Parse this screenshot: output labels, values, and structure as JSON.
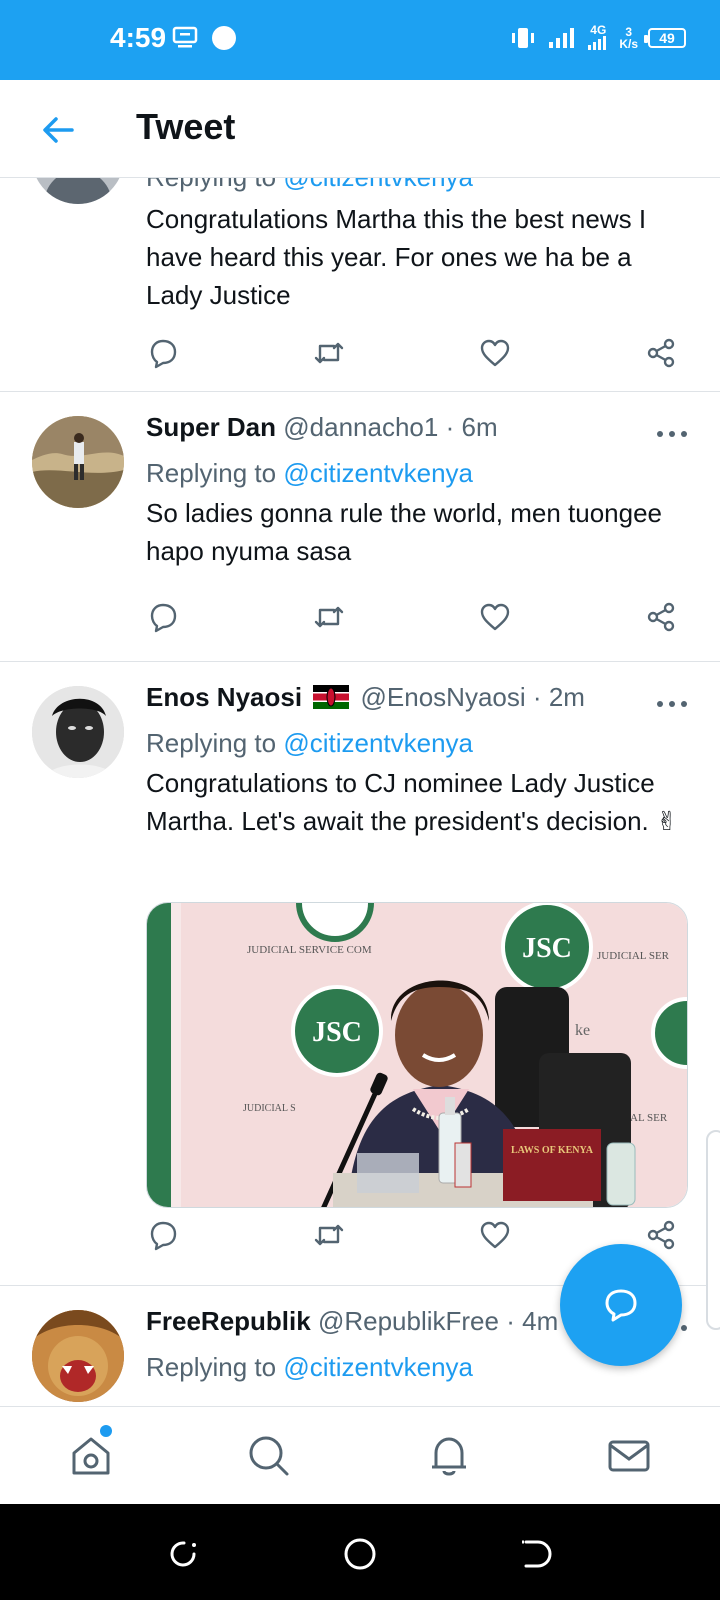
{
  "status_bar": {
    "time": "4:59",
    "network_type": "4G",
    "speed_value": "3",
    "speed_unit": "K/s",
    "battery": "49"
  },
  "header": {
    "title": "Tweet",
    "back_icon": "arrow-left-icon"
  },
  "tweets": [
    {
      "reply_prefix": "Replying to",
      "reply_handle": "@citizentvkenya",
      "text": "Congratulations Martha this the best news I have heard this year. For ones we ha be a Lady Justice"
    },
    {
      "name": "Super Dan",
      "handle": "@dannacho1",
      "time": "6m",
      "reply_prefix": "Replying to",
      "reply_handle": "@citizentvkenya",
      "text": "So ladies gonna rule the world, men tuongee hapo nyuma sasa"
    },
    {
      "name": "Enos Nyaosi",
      "handle": "@EnosNyaosi",
      "time": "2m",
      "reply_prefix": "Replying to",
      "reply_handle": "@citizentvkenya",
      "text": "Congratulations to CJ nominee Lady Justice Martha. Let's await the president's decision. ✌",
      "media": {
        "banner_left": "JUDICIAL SERVICE COM",
        "banner_right": "JUDICIAL SER",
        "banner_lower_left": "JUDICIAL S",
        "banner_lower_right": "CIAL SER",
        "seal_text": "JSC",
        "book_title": "LAWS OF KENYA",
        "partial_word": "ke"
      }
    },
    {
      "name": "FreeRepublik",
      "handle": "@RepublikFree",
      "time": "4m",
      "reply_prefix": "Replying to",
      "reply_handle": "@citizentvkenya"
    }
  ],
  "separator": "·",
  "icons": {
    "reply": "reply-icon",
    "retweet": "retweet-icon",
    "like": "like-icon",
    "share": "share-icon",
    "more": "more-icon",
    "compose": "compose-reply-icon"
  },
  "bottom_nav": [
    "home-icon",
    "search-icon",
    "notifications-icon",
    "messages-icon"
  ],
  "colors": {
    "accent": "#1da1f2",
    "link": "#1d9bf0",
    "text": "#0f1419",
    "muted": "#536471"
  }
}
